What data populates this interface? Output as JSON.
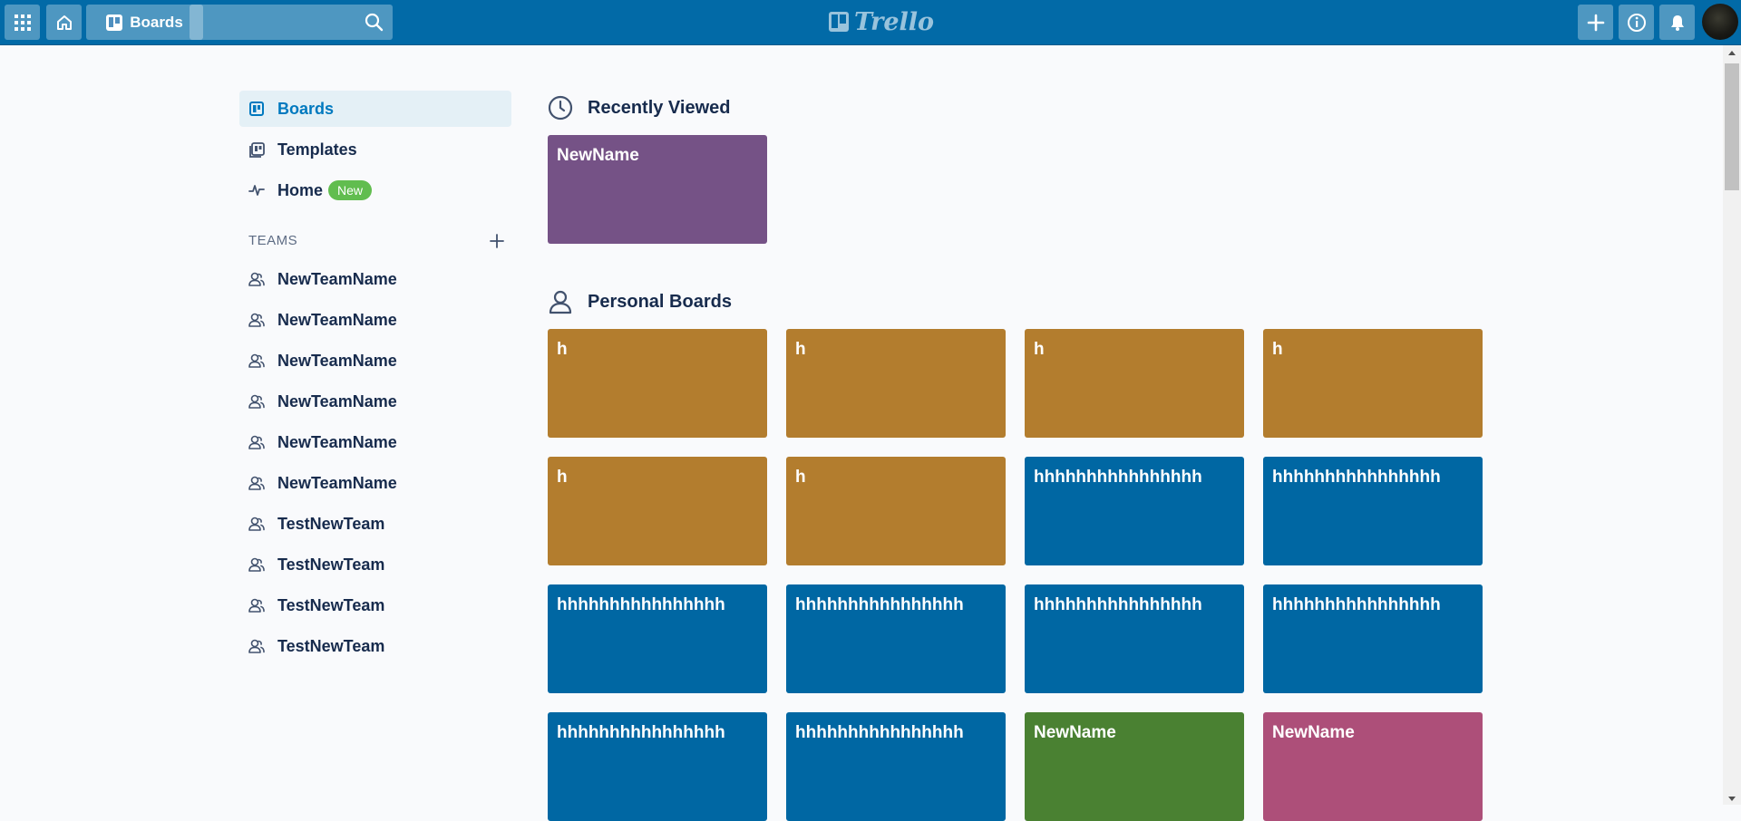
{
  "header": {
    "boards_label": "Boards",
    "search_value": "",
    "logo_text": "Trello"
  },
  "sidebar": {
    "items": [
      {
        "label": "Boards",
        "icon": "board-icon",
        "active": true
      },
      {
        "label": "Templates",
        "icon": "templates-icon"
      },
      {
        "label": "Home",
        "icon": "activity-icon",
        "badge": "New"
      }
    ],
    "teams_label": "TEAMS",
    "teams": [
      "NewTeamName",
      "NewTeamName",
      "NewTeamName",
      "NewTeamName",
      "NewTeamName",
      "NewTeamName",
      "TestNewTeam",
      "TestNewTeam",
      "TestNewTeam",
      "TestNewTeam"
    ]
  },
  "recent": {
    "title": "Recently Viewed",
    "boards": [
      {
        "name": "NewName",
        "color": "#755286"
      }
    ]
  },
  "personal": {
    "title": "Personal Boards",
    "boards": [
      {
        "name": "h",
        "color": "#b37d2e"
      },
      {
        "name": "h",
        "color": "#b37d2e"
      },
      {
        "name": "h",
        "color": "#b37d2e"
      },
      {
        "name": "h",
        "color": "#b37d2e"
      },
      {
        "name": "h",
        "color": "#b37d2e"
      },
      {
        "name": "h",
        "color": "#b37d2e"
      },
      {
        "name": "hhhhhhhhhhhhhhhh",
        "color": "#0067a3"
      },
      {
        "name": "hhhhhhhhhhhhhhhh",
        "color": "#0067a3"
      },
      {
        "name": "hhhhhhhhhhhhhhhh",
        "color": "#0067a3"
      },
      {
        "name": "hhhhhhhhhhhhhhhh",
        "color": "#0067a3"
      },
      {
        "name": "hhhhhhhhhhhhhhhh",
        "color": "#0067a3"
      },
      {
        "name": "hhhhhhhhhhhhhhhh",
        "color": "#0067a3"
      },
      {
        "name": "hhhhhhhhhhhhhhhh",
        "color": "#0067a3"
      },
      {
        "name": "hhhhhhhhhhhhhhhh",
        "color": "#0067a3"
      },
      {
        "name": "NewName",
        "color": "#4a8132"
      },
      {
        "name": "NewName",
        "color": "#ad4f79"
      }
    ]
  },
  "colors": {
    "header": "#026aa7",
    "accent": "#0079bf",
    "badge": "#61bd4f"
  }
}
